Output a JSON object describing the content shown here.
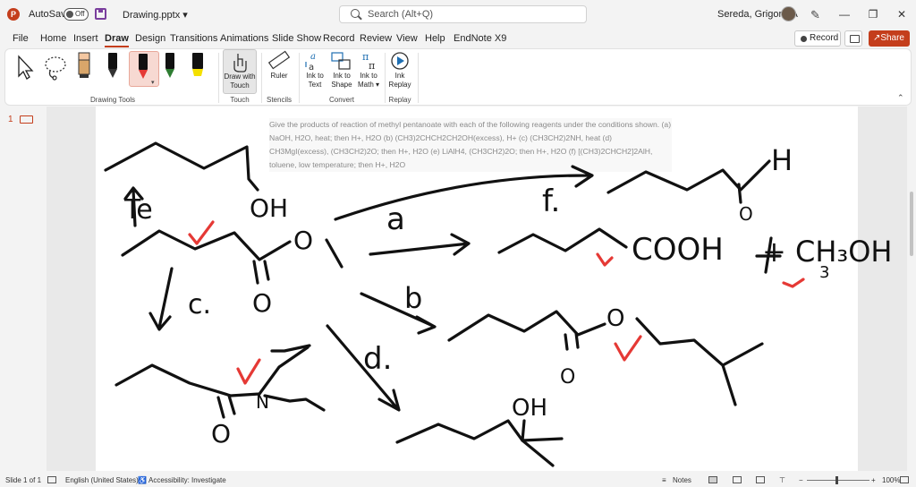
{
  "titlebar": {
    "app_icon_glyph": "P",
    "autosave_label": "AutoSave",
    "autosave_state": "Off",
    "document_title": "Drawing.pptx",
    "search_placeholder": "Search (Alt+Q)",
    "user_name": "Sereda, Grigoriy A",
    "minimize_glyph": "—",
    "restore_glyph": "❐",
    "close_glyph": "✕",
    "dropdown_glyph": "▾"
  },
  "menu": {
    "items": [
      "File",
      "Home",
      "Insert",
      "Draw",
      "Design",
      "Transitions",
      "Animations",
      "Slide Show",
      "Record",
      "Review",
      "View",
      "Help",
      "EndNote X9"
    ],
    "active": "Draw",
    "record_label": "Record",
    "share_label": "Share"
  },
  "ribbon": {
    "groups": {
      "drawing_tools": "Drawing Tools",
      "touch": "Touch",
      "stencils": "Stencils",
      "convert": "Convert",
      "replay": "Replay"
    },
    "buttons": {
      "draw_with_touch_line1": "Draw with",
      "draw_with_touch_line2": "Touch",
      "ruler": "Ruler",
      "ink_to_text_line1": "Ink to",
      "ink_to_text_line2": "Text",
      "ink_to_shape_line1": "Ink to",
      "ink_to_shape_line2": "Shape",
      "ink_to_math_line1": "Ink to",
      "ink_to_math_line2": "Math ▾",
      "ink_replay_line1": "Ink",
      "ink_replay_line2": "Replay"
    },
    "pen_colors": [
      "#000000",
      "#1a1a1a",
      "#e53935",
      "#2e7d32",
      "#f4e000"
    ],
    "accent_color": "#c43e1c"
  },
  "slide_panel": {
    "slide_number": "1"
  },
  "slide": {
    "question_text": "Give the products of reaction of methyl pentanoate with each of the following reagents under the conditions shown. (a) NaOH, H2O, heat; then H+, H2O (b) (CH3)2CHCH2CH2OH(excess), H+ (c) (CH3CH2)2NH, heat (d) CH3MgI(excess), (CH3CH2)2O; then H+, H2O (e) LiAlH4, (CH3CH2)2O; then H+, H2O (f) [(CH3)2CHCH2]2AlH, toluene, low temperature; then H+, H2O",
    "ink_labels": {
      "te": "Te",
      "oh_top": "OH",
      "h_top": "H",
      "o_top": "O",
      "a": "a",
      "f": "f.",
      "o_ester": "O",
      "o_ester2": "O",
      "cooh": "COOH",
      "plus_methanol": "+ CH₃OH",
      "three": "3",
      "c": "c.",
      "b": "b",
      "o_b": "O",
      "o_b2": "O",
      "d": "d.",
      "oh_d": "OH",
      "n": "N",
      "o_c": "O"
    }
  },
  "statusbar": {
    "slide_of": "Slide 1 of 1",
    "language": "English (United States)",
    "accessibility": "Accessibility: Investigate",
    "notes": "Notes",
    "zoom": "100%",
    "zoom_minus": "−",
    "zoom_plus": "+"
  }
}
